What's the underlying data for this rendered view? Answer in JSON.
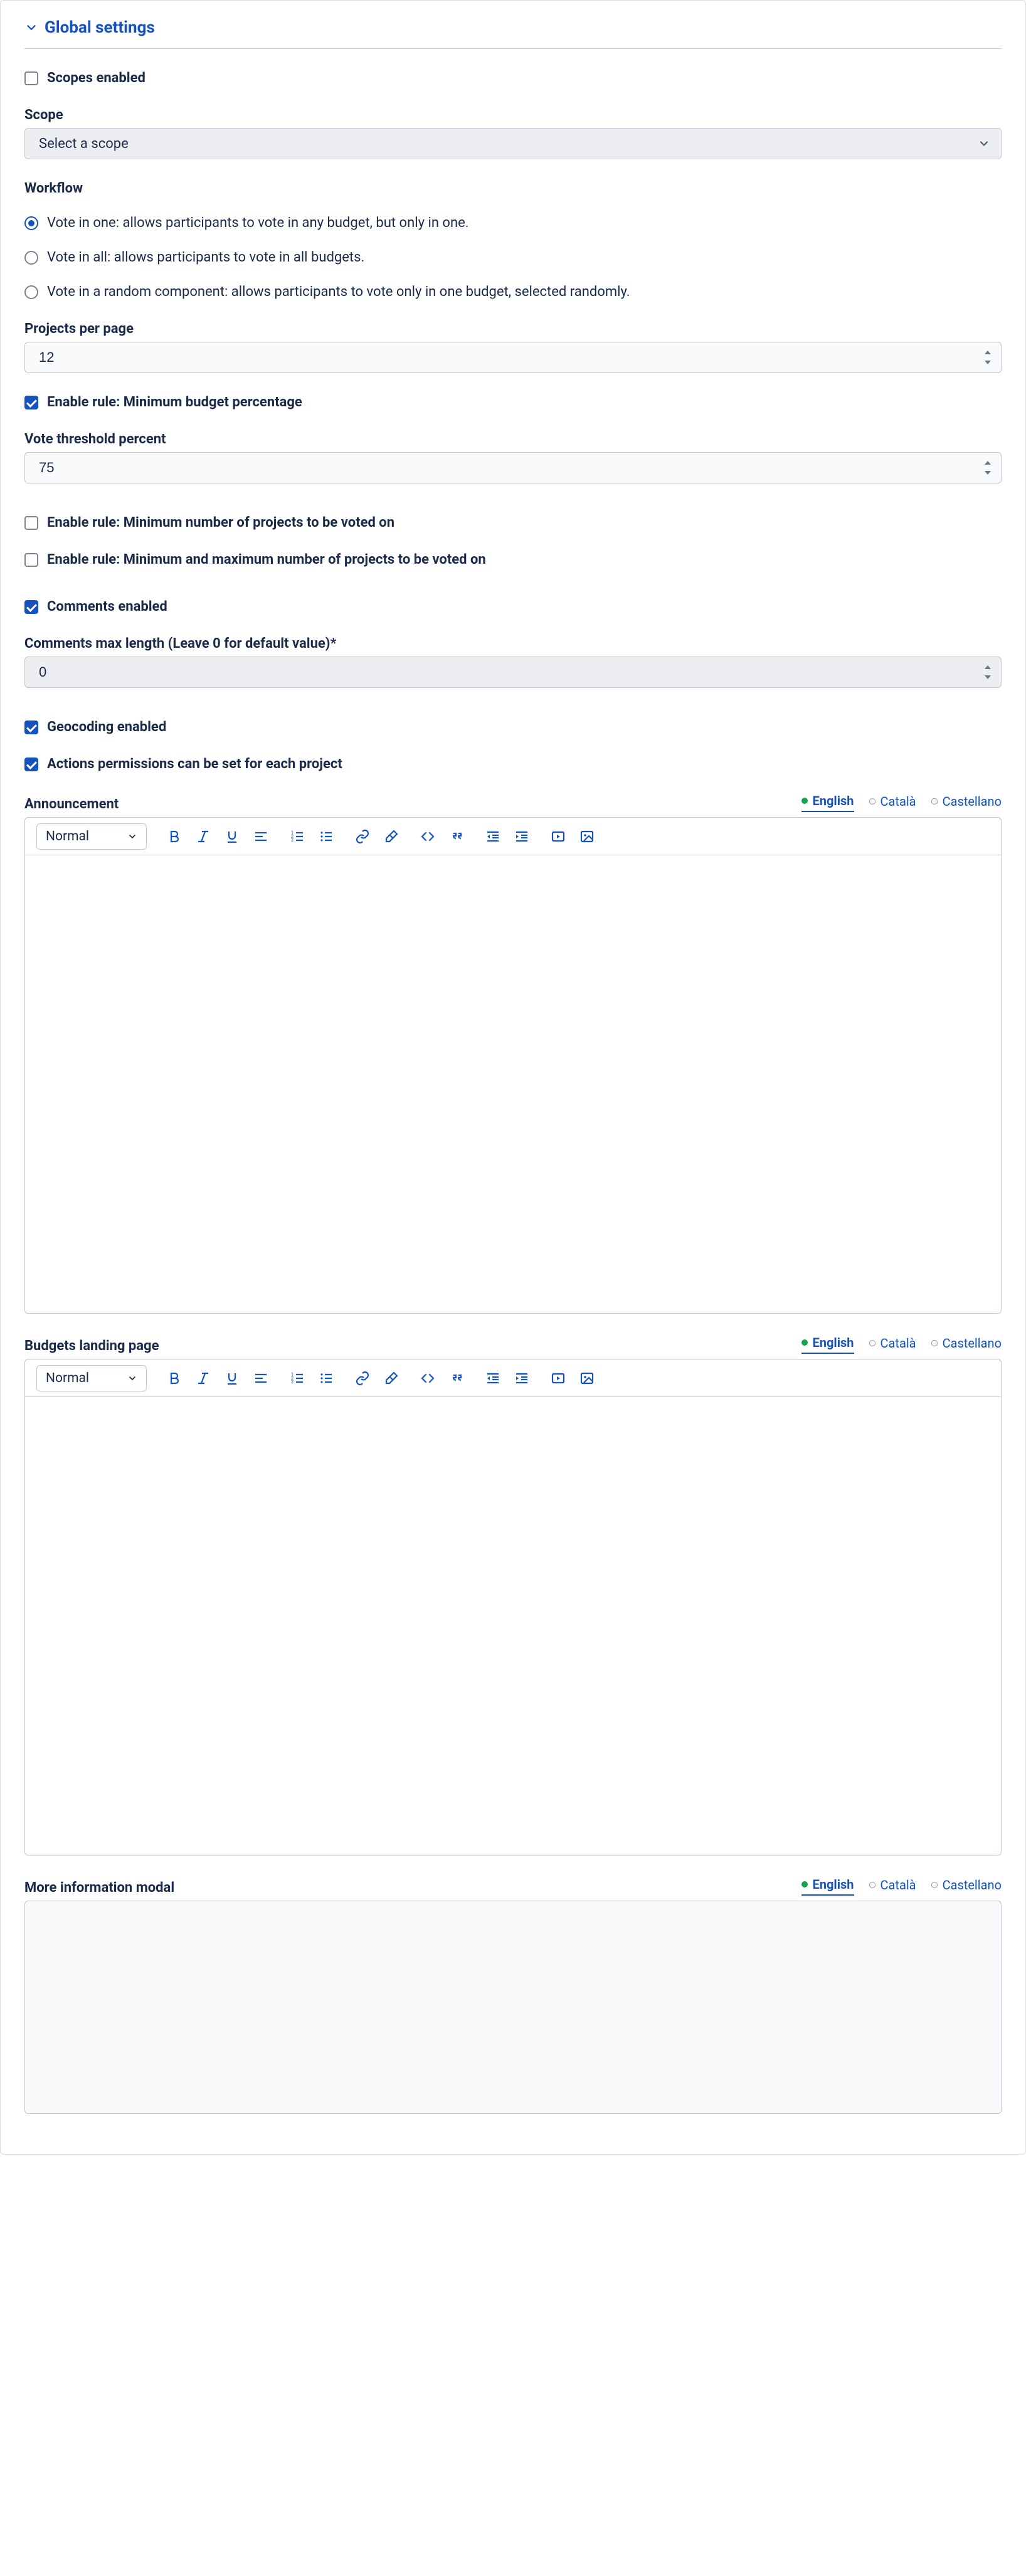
{
  "section_title": "Global settings",
  "scopes_enabled": {
    "label": "Scopes enabled",
    "checked": false
  },
  "scope": {
    "label": "Scope",
    "selected": "Select a scope"
  },
  "workflow": {
    "label": "Workflow",
    "selected_index": 0,
    "options": [
      "Vote in one: allows participants to vote in any budget, but only in one.",
      "Vote in all: allows participants to vote in all budgets.",
      "Vote in a random component: allows participants to vote only in one budget, selected randomly."
    ]
  },
  "projects_per_page": {
    "label": "Projects per page",
    "value": "12"
  },
  "rule_min_budget_pct": {
    "label": "Enable rule: Minimum budget percentage",
    "checked": true
  },
  "vote_threshold_pct": {
    "label": "Vote threshold percent",
    "value": "75"
  },
  "rule_min_num_projects": {
    "label": "Enable rule: Minimum number of projects to be voted on",
    "checked": false
  },
  "rule_min_max_projects": {
    "label": "Enable rule: Minimum and maximum number of projects to be voted on",
    "checked": false
  },
  "comments_enabled": {
    "label": "Comments enabled",
    "checked": true
  },
  "comments_max_length": {
    "label": "Comments max length (Leave 0 for default value)*",
    "value": "0"
  },
  "geocoding_enabled": {
    "label": "Geocoding enabled",
    "checked": true
  },
  "actions_permissions": {
    "label": "Actions permissions can be set for each project",
    "checked": true
  },
  "languages": {
    "active": 0,
    "tabs": [
      "English",
      "Català",
      "Castellano"
    ]
  },
  "announcement": {
    "label": "Announcement"
  },
  "budgets_landing": {
    "label": "Budgets landing page"
  },
  "more_info_modal": {
    "label": "More information modal"
  },
  "editor": {
    "format_label": "Normal"
  }
}
